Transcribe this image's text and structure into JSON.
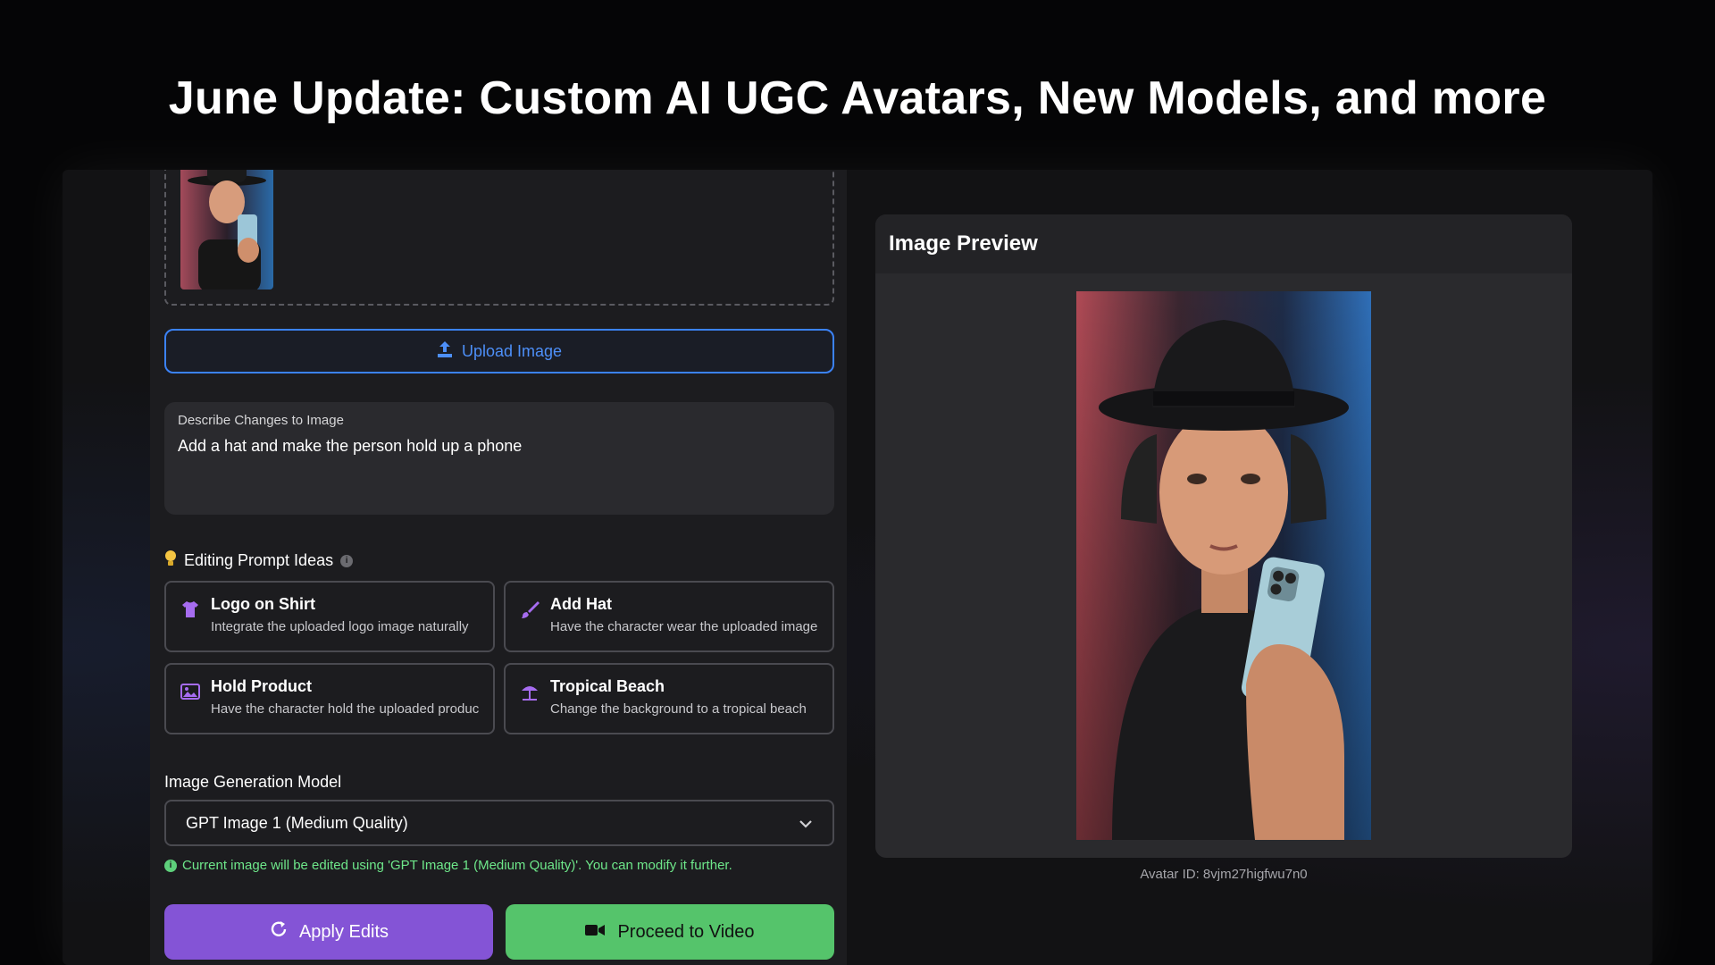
{
  "headline": "June Update: Custom AI UGC Avatars, New Models, and more",
  "upload": {
    "button_label": "Upload Image",
    "icon": "upload-icon"
  },
  "prompt": {
    "label": "Describe Changes to Image",
    "value": "Add a hat and make the person hold up a phone"
  },
  "ideas": {
    "header": "Editing Prompt Ideas",
    "header_icon": "lightbulb-icon",
    "items": [
      {
        "title": "Logo on Shirt",
        "desc": "Integrate the uploaded logo image naturally",
        "icon": "shirt-icon",
        "color": "#a66cf0"
      },
      {
        "title": "Add Hat",
        "desc": "Have the character wear the uploaded image",
        "icon": "brush-icon",
        "color": "#a66cf0"
      },
      {
        "title": "Hold Product",
        "desc": "Have the character hold the uploaded product",
        "icon": "image-icon",
        "color": "#a66cf0"
      },
      {
        "title": "Tropical Beach",
        "desc": "Change the background to a tropical beach",
        "icon": "beach-umbrella-icon",
        "color": "#a66cf0"
      }
    ]
  },
  "model": {
    "label": "Image Generation Model",
    "selected": "GPT Image 1 (Medium Quality)",
    "note": "Current image will be edited using 'GPT Image 1 (Medium Quality)'. You can modify it further."
  },
  "actions": {
    "apply_label": "Apply Edits",
    "proceed_label": "Proceed to Video"
  },
  "preview": {
    "title": "Image Preview",
    "avatar_id": "Avatar ID: 8vjm27higfwu7n0"
  },
  "colors": {
    "accent_blue": "#3b82f6",
    "apply_purple": "#8454d6",
    "proceed_green": "#55c46b",
    "note_green": "#6ee78a"
  }
}
